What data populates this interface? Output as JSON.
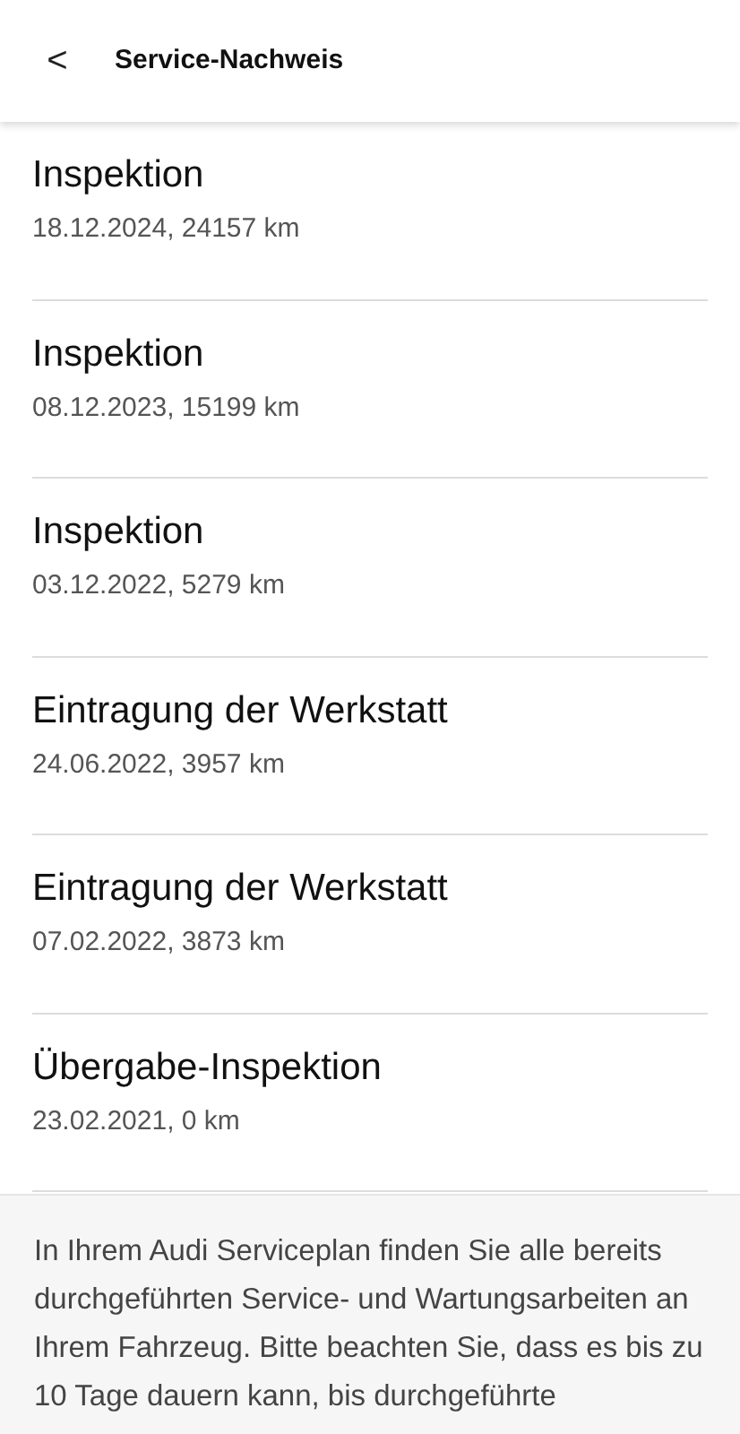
{
  "header": {
    "back_icon": "<",
    "title": "Service-Nachweis"
  },
  "entries": [
    {
      "title": "Inspektion",
      "detail": "18.12.2024, 24157 km"
    },
    {
      "title": "Inspektion",
      "detail": "08.12.2023, 15199 km"
    },
    {
      "title": "Inspektion",
      "detail": "03.12.2022, 5279 km"
    },
    {
      "title": "Eintragung der Werkstatt",
      "detail": "24.06.2022, 3957 km"
    },
    {
      "title": "Eintragung der Werkstatt",
      "detail": "07.02.2022, 3873 km"
    },
    {
      "title": "Übergabe-Inspektion",
      "detail": "23.02.2021, 0 km"
    }
  ],
  "info_text": "In Ihrem Audi Serviceplan finden Sie alle bereits durchgeführten Service- und Wartungsarbeiten an Ihrem Fahrzeug. Bitte beachten Sie, dass es bis zu 10 Tage dauern kann, bis durchgeführte"
}
